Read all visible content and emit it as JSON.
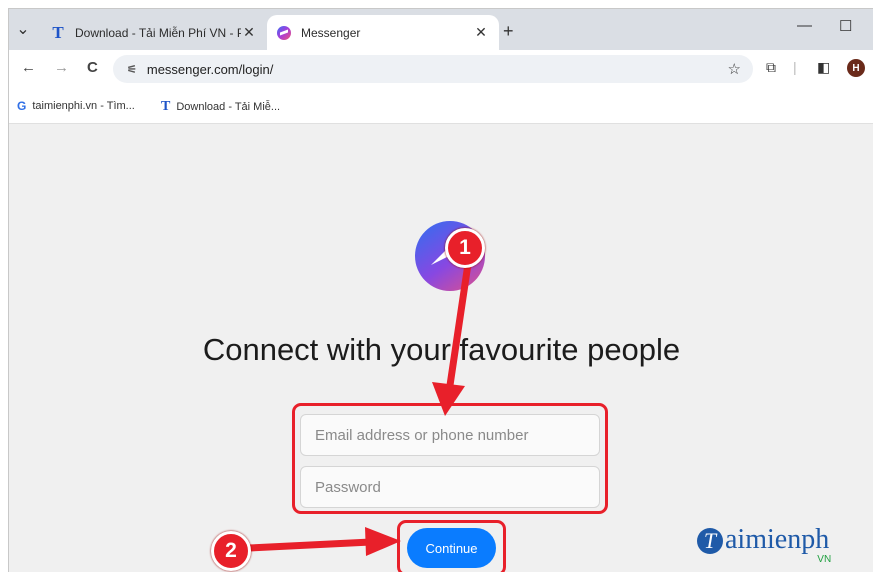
{
  "tabs": [
    {
      "label": "Download - Tải Miễn Phí VN - P",
      "icon": "T",
      "close": "✕"
    },
    {
      "label": "Messenger",
      "icon": "messenger-icon",
      "close": "✕"
    }
  ],
  "tab_menu": "⌄",
  "new_tab": "+",
  "window_controls": {
    "minimize": "—",
    "maximize": "☐"
  },
  "nav": {
    "back": "←",
    "forward": "→",
    "reload": "C"
  },
  "address": {
    "url": "messenger.com/login/",
    "star": "☆"
  },
  "profile_initial": "H",
  "bookmarks": [
    {
      "icon": "G",
      "label": "taimienphi.vn - Tìm..."
    },
    {
      "icon": "T",
      "label": "Download - Tải Miễ..."
    }
  ],
  "page": {
    "heading": "Connect with your favourite people",
    "email_placeholder": "Email address or phone number",
    "password_placeholder": "Password",
    "continue_label": "Continue"
  },
  "annotations": {
    "step1": "1",
    "step2": "2",
    "color": "#e8202a"
  },
  "watermark": {
    "letter": "T",
    "text": "aimienph",
    "sub": "VN"
  }
}
